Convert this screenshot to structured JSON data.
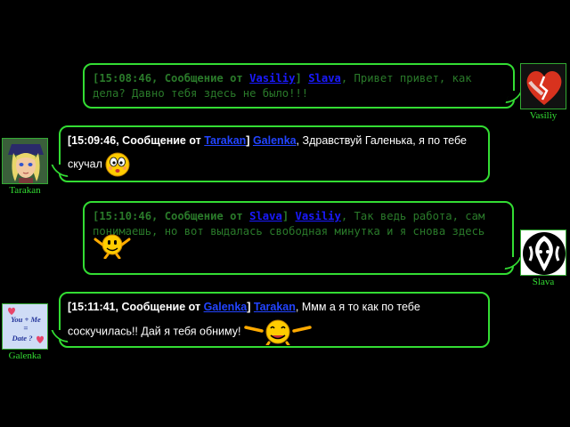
{
  "messages": [
    {
      "time": "[15:08:46,",
      "label": "Сообщение от",
      "from": "Vasiliy",
      "bracket": "]",
      "to": "Slava",
      "text": ", Привет привет, как дела? Давно тебя здесь не было!!!"
    },
    {
      "time": "[15:09:46,",
      "label": "Сообщение от",
      "from": "Tarakan",
      "bracket": "]",
      "to": "Galenka",
      "text": ", Здравствуй Галенька, я по тебе скучал"
    },
    {
      "time": "[15:10:46,",
      "label": "Сообщение от",
      "from": "Slava",
      "bracket": "]",
      "to": "Vasiliy",
      "text": ", Так ведь работа, сам понимаешь, но вот выдалась свободная минутка и я снова здесь"
    },
    {
      "time": "[15:11:41,",
      "label": "Сообщение от",
      "from": "Galenka",
      "bracket": "]",
      "to": "Tarakan",
      "text": ", Ммм а я то как по тебе соскучилась!! Дай я тебя обниму!"
    }
  ],
  "avatars": {
    "vasiliy": {
      "name": "Vasiliy",
      "icon": "broken-heart-icon"
    },
    "tarakan": {
      "name": "Tarakan",
      "icon": "anime-character-portrait"
    },
    "slava": {
      "name": "Slava",
      "icon": "tribal-face-icon"
    },
    "galenka": {
      "name": "Galenka",
      "icon": "you-plus-me-date-heart-icon",
      "img_lines": [
        "You + Me",
        "=",
        "Date ?"
      ]
    }
  },
  "colors": {
    "background": "#000000",
    "bubble_border": "#33dd33",
    "mono_text": "#2a7a2a",
    "nick_link": "#1a1aff",
    "sans_text": "#ffffff",
    "avatar_name": "#33dd33"
  }
}
